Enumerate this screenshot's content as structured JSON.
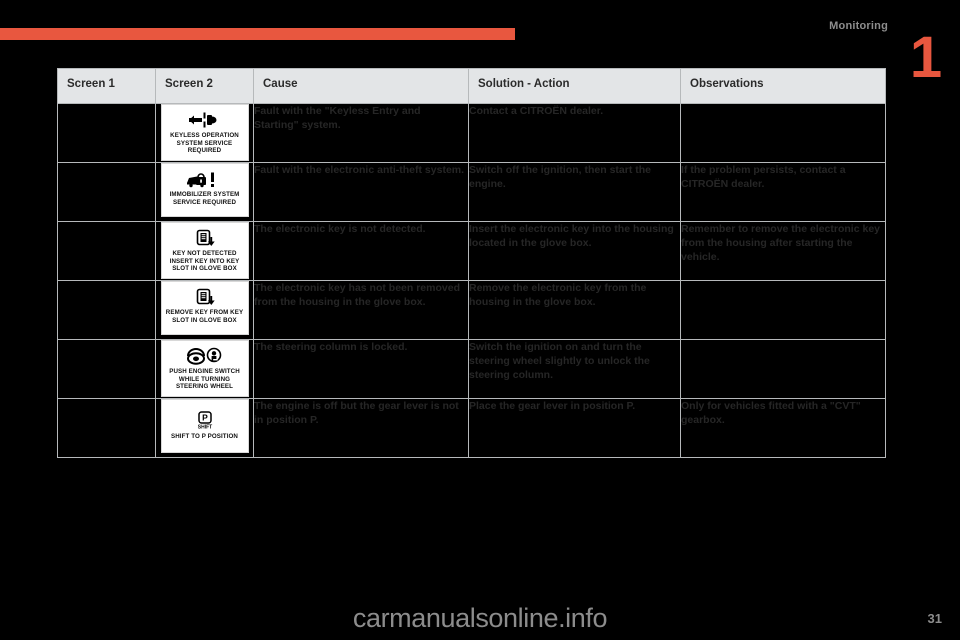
{
  "header": {
    "section_title": "Monitoring",
    "chapter_number": "1",
    "accent_color": "#e8573f"
  },
  "table": {
    "columns": [
      {
        "key": "screen1",
        "label": "Screen 1"
      },
      {
        "key": "screen2",
        "label": "Screen 2"
      },
      {
        "key": "cause",
        "label": "Cause"
      },
      {
        "key": "solution",
        "label": "Solution - Action"
      },
      {
        "key": "observations",
        "label": "Observations"
      }
    ],
    "rows": [
      {
        "screen1": "",
        "screen2": {
          "icon": "keyless-remote-icon",
          "text": "KEYLESS OPERATION\nSYSTEM SERVICE\nREQUIRED"
        },
        "cause": "Fault with the \"Keyless Entry and Starting\" system.",
        "solution": "Contact a CITROËN dealer.",
        "observations": ""
      },
      {
        "screen1": "",
        "screen2": {
          "icon": "car-lock-warning-icon",
          "text": "IMMOBILIZER SYSTEM\nSERVICE REQUIRED"
        },
        "cause": "Fault with the electronic anti-theft system.",
        "solution": "Switch off the ignition, then start the engine.",
        "observations": "If the problem persists, contact a CITROËN dealer."
      },
      {
        "screen1": "",
        "screen2": {
          "icon": "key-slot-insert-icon",
          "text": "KEY NOT DETECTED\nINSERT KEY INTO KEY\nSLOT IN GLOVE BOX"
        },
        "cause": "The electronic key is not detected.",
        "solution": "Insert the electronic key into the housing located in the glove box.",
        "observations": "Remember to remove the electronic key from the housing after starting the vehicle."
      },
      {
        "screen1": "",
        "screen2": {
          "icon": "key-slot-remove-icon",
          "text": "REMOVE KEY FROM KEY\nSLOT IN GLOVE BOX"
        },
        "cause": "The electronic key has not been removed from the housing in the glove box.",
        "solution": "Remove the electronic key from the housing in the glove box.",
        "observations": ""
      },
      {
        "screen1": "",
        "screen2": {
          "icon": "steering-wheel-push-button-icon",
          "text": "PUSH ENGINE SWITCH\nWHILE TURNING\nSTEERING WHEEL"
        },
        "cause": "The steering column is locked.",
        "solution": "Switch the ignition on and turn the steering wheel slightly to unlock the steering column.",
        "observations": ""
      },
      {
        "screen1": "",
        "screen2": {
          "icon": "park-shift-icon",
          "text": "SHIFT TO P POSITION"
        },
        "cause": "The engine is off but the gear lever is not in position P.",
        "solution": "Place the gear lever in position P.",
        "observations": "Only for vehicles fitted with a \"CVT\" gearbox."
      }
    ]
  },
  "footer": {
    "watermark": "carmanualsonline.info",
    "page_number": "31"
  }
}
